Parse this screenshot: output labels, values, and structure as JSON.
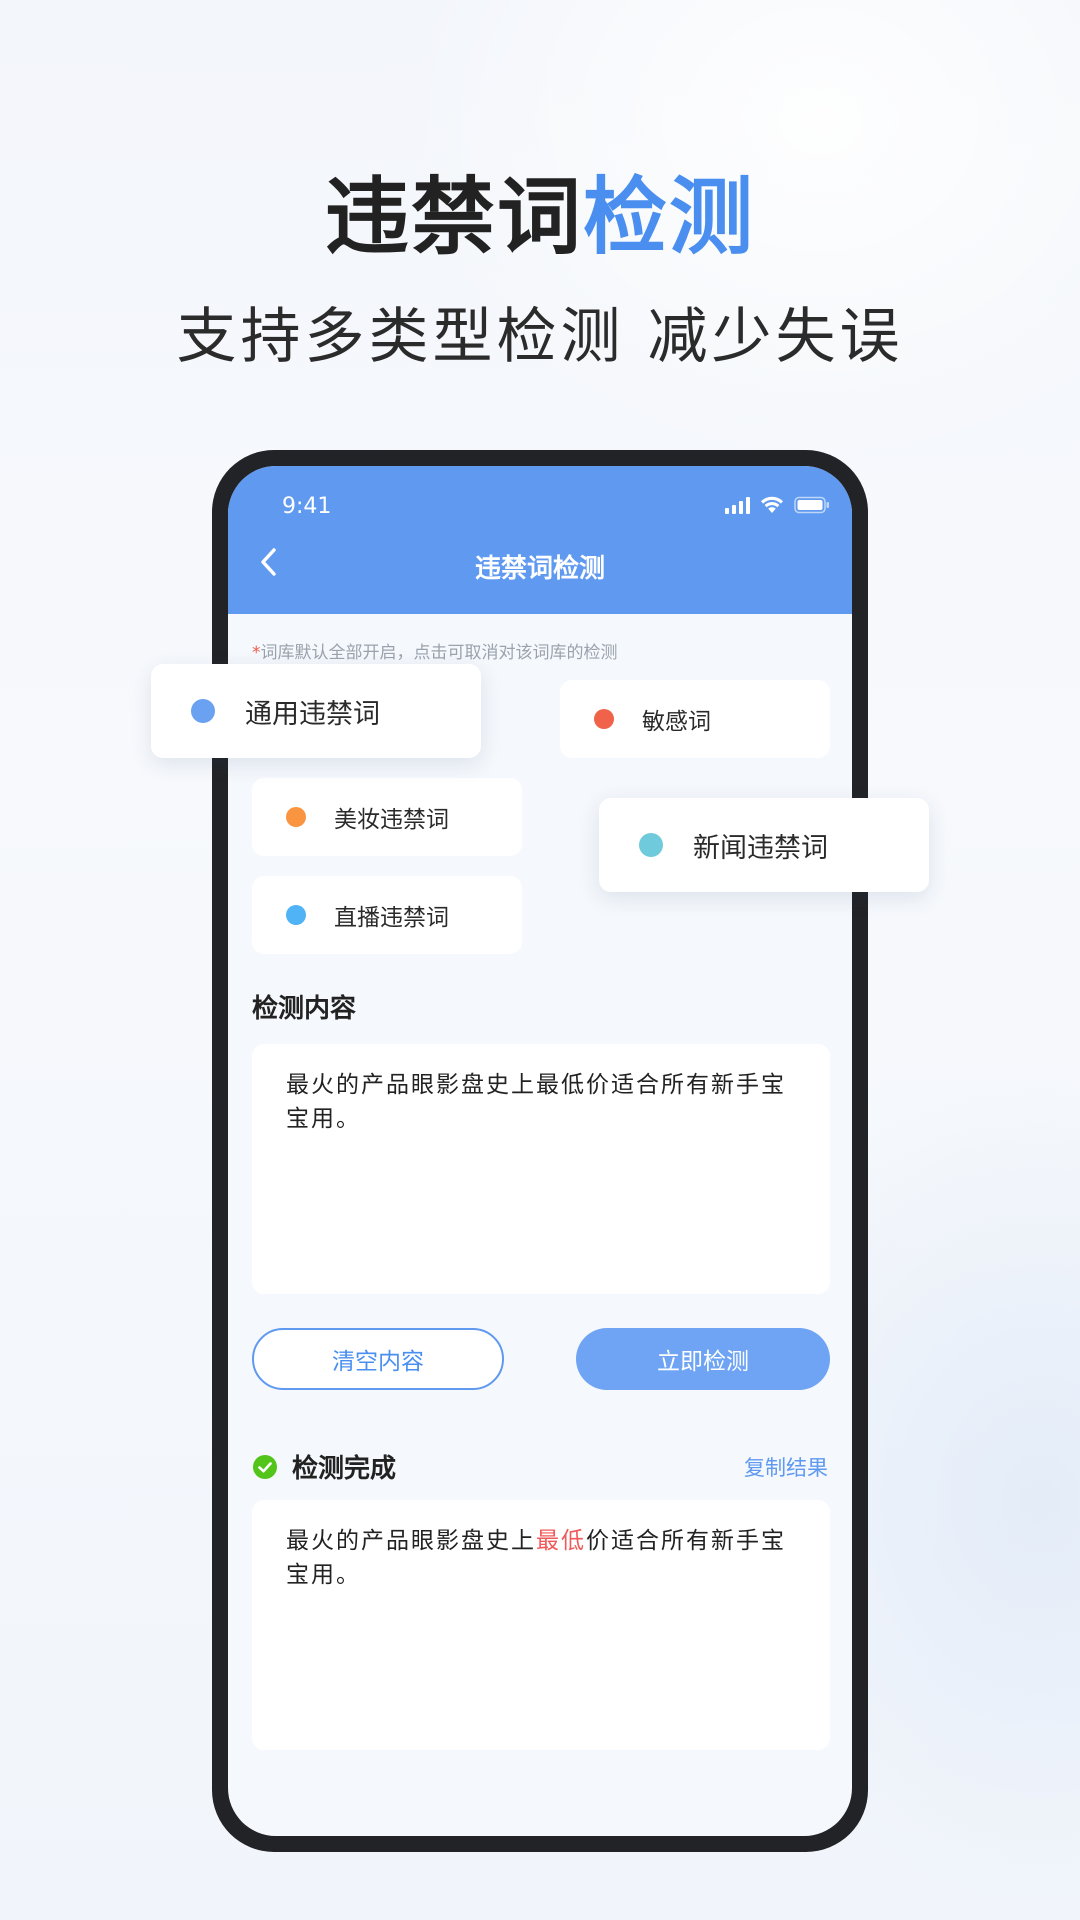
{
  "hero": {
    "title_main": "违禁词",
    "title_accent": "检测",
    "subtitle": "支持多类型检测 减少失误"
  },
  "status_bar": {
    "time": "9:41",
    "icons": [
      "signal-icon",
      "wifi-icon",
      "battery-icon"
    ]
  },
  "nav": {
    "back_icon": "chevron-left-icon",
    "title": "违禁词检测"
  },
  "hint": {
    "star": "*",
    "text": "词库默认全部开启，点击可取消对该词库的检测"
  },
  "categories": [
    {
      "label": "通用违禁词",
      "color": "#6aa1f0",
      "floating": true
    },
    {
      "label": "敏感词",
      "color": "#f0634a",
      "floating": false
    },
    {
      "label": "美妆违禁词",
      "color": "#f99440",
      "floating": false
    },
    {
      "label": "新闻违禁词",
      "color": "#6fcadb",
      "floating": true
    },
    {
      "label": "直播违禁词",
      "color": "#4fb3f5",
      "floating": false
    }
  ],
  "input_section": {
    "title": "检测内容",
    "content": "最火的产品眼影盘史上最低价适合所有新手宝宝用。"
  },
  "buttons": {
    "clear": "清空内容",
    "check": "立即检测"
  },
  "result_section": {
    "status": "检测完成",
    "status_icon": "check-circle-icon",
    "status_color": "#52c41a",
    "copy": "复制结果",
    "text_before": "最火的产品眼影盘史上",
    "flagged": "最低",
    "text_after": "价适合所有新手宝宝用。",
    "flag_color": "#f05a5a"
  },
  "colors": {
    "accent": "#4a8ff0",
    "appbar": "#5f99f0",
    "primary_button": "#6ea4f3"
  }
}
